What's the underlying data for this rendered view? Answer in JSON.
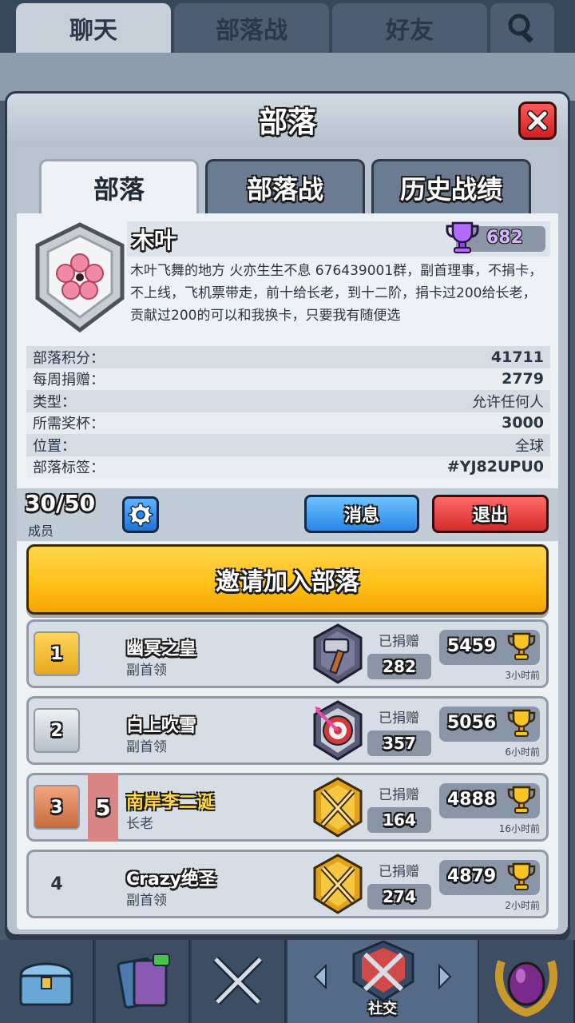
{
  "top_tabs": [
    "聊天",
    "部落战",
    "好友"
  ],
  "panel": {
    "title": "部落",
    "subtabs": [
      "部落",
      "部落战",
      "历史战绩"
    ]
  },
  "clan": {
    "name": "木叶",
    "trophies": "682",
    "description": "木叶飞舞的地方 火亦生生不息 676439001群，副首理事，不捐卡，不上线，飞机票带走，前十给长老，到十二阶，捐卡过200给长老，贡献过200的可以和我换卡，只要我有随便选",
    "stats": [
      {
        "label": "部落积分：",
        "value": "41711"
      },
      {
        "label": "每周捐赠：",
        "value": "2779"
      },
      {
        "label": "类型：",
        "value": "允许任何人"
      },
      {
        "label": "所需奖杯：",
        "value": "3000"
      },
      {
        "label": "位置：",
        "value": "全球"
      },
      {
        "label": "部落标签：",
        "value": "#YJ82UPU0"
      }
    ]
  },
  "members_bar": {
    "count": "30/50",
    "label": "成员",
    "message_button": "消息",
    "leave_button": "退出"
  },
  "invite_button": "邀请加入部落",
  "members": [
    {
      "rank": "1",
      "change": "",
      "name": "幽冥之皇",
      "role": "副首领",
      "donated_label": "已捐赠",
      "donated": "282",
      "trophies": "5459",
      "last_seen": "3小时前",
      "arena_icon": "hammer-arena-icon"
    },
    {
      "rank": "2",
      "change": "",
      "name": "白上吹雪",
      "role": "副首领",
      "donated_label": "已捐赠",
      "donated": "357",
      "trophies": "5056",
      "last_seen": "6小时前",
      "arena_icon": "target-arena-icon"
    },
    {
      "rank": "3",
      "change": "5",
      "name": "南岸李二诞",
      "role": "长老",
      "donated_label": "已捐赠",
      "donated": "164",
      "trophies": "4888",
      "last_seen": "16小时前",
      "arena_icon": "crossed-swords-arena-icon"
    },
    {
      "rank": "4",
      "change": "",
      "name": "Crazy绝圣",
      "role": "副首领",
      "donated_label": "已捐赠",
      "donated": "274",
      "trophies": "4879",
      "last_seen": "2小时前",
      "arena_icon": "crossed-swords-arena-icon"
    }
  ],
  "bottom_nav": {
    "active_label": "社交"
  },
  "colors": {
    "invite_yellow": "#ffc21a",
    "leave_red": "#d42a2a",
    "message_blue": "#2a86e6",
    "trophy_purple": "#b36bff"
  }
}
